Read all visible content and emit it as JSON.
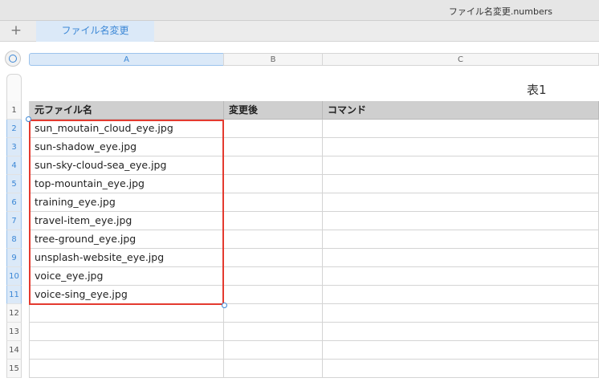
{
  "window": {
    "title": "ファイル名変更.numbers"
  },
  "toolbar": {
    "add_sheet_label": "+",
    "sheet_tab_label": "ファイル名変更"
  },
  "columns": [
    "A",
    "B",
    "C"
  ],
  "table": {
    "name": "表1",
    "headers": [
      "元ファイル名",
      "変更後",
      "コマンド"
    ],
    "rows": [
      [
        "sun_moutain_cloud_eye.jpg",
        "",
        ""
      ],
      [
        "sun-shadow_eye.jpg",
        "",
        ""
      ],
      [
        "sun-sky-cloud-sea_eye.jpg",
        "",
        ""
      ],
      [
        "top-mountain_eye.jpg",
        "",
        ""
      ],
      [
        "training_eye.jpg",
        "",
        ""
      ],
      [
        "travel-item_eye.jpg",
        "",
        ""
      ],
      [
        "tree-ground_eye.jpg",
        "",
        ""
      ],
      [
        "unsplash-website_eye.jpg",
        "",
        ""
      ],
      [
        "voice_eye.jpg",
        "",
        ""
      ],
      [
        "voice-sing_eye.jpg",
        "",
        ""
      ],
      [
        "",
        "",
        ""
      ],
      [
        "",
        "",
        ""
      ],
      [
        "",
        "",
        ""
      ],
      [
        "",
        "",
        ""
      ]
    ]
  },
  "row_numbers": [
    "1",
    "2",
    "3",
    "4",
    "5",
    "6",
    "7",
    "8",
    "9",
    "10",
    "11",
    "12",
    "13",
    "14",
    "15"
  ],
  "selection": {
    "range": "A2:A11",
    "color": "#e43a2f"
  },
  "colors": {
    "accent": "#3b87d6",
    "header_fill": "#cfcfcf",
    "selection_border": "#e43a2f"
  }
}
